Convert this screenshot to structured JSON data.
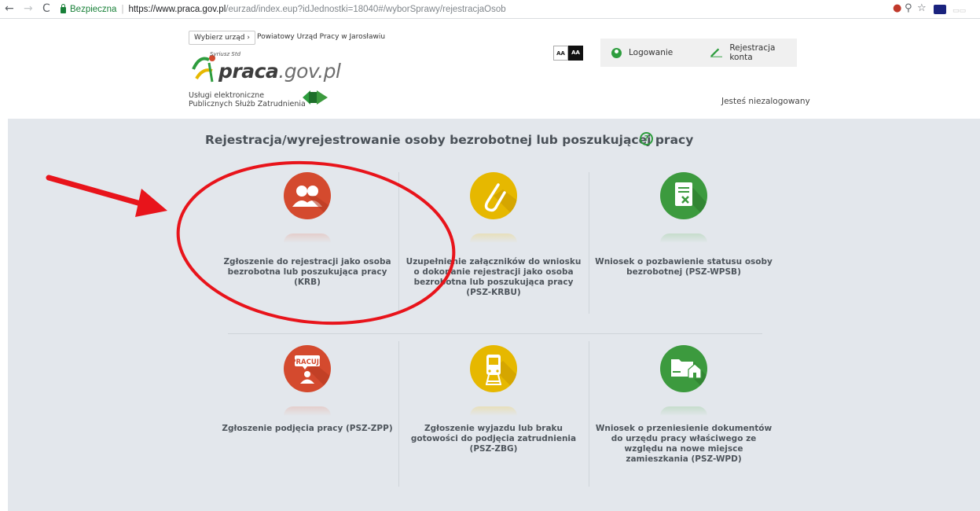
{
  "browser": {
    "secure_label": "Bezpieczna",
    "url_host": "https://www.praca.gov.pl",
    "url_path": "/eurzad/index.eup?idJednostki=18040#/wyborSprawy/rejestracjaOsob"
  },
  "header": {
    "choose_office": "Wybierz urząd  ›",
    "office_name": "Powiatowy Urząd Pracy w Jarosławiu",
    "logo_main": "praca",
    "logo_domain": ".gov.pl",
    "logo_sub": "Syriusz Std",
    "psz_line1": "Usługi elektroniczne",
    "psz_line2": "Publicznych Służb Zatrudnienia",
    "aa_small": "AA",
    "aa_large": "AA",
    "login": "Logowanie",
    "register": "Rejestracja konta",
    "status": "Jesteś niezalogowany"
  },
  "main": {
    "title": "Rejestracja/wyrejestrowanie osoby bezrobotnej lub poszukującej pracy",
    "help": "?",
    "tiles": [
      {
        "lines": [
          "Zgłoszenie do rejestracji jako osoba",
          "bezrobotna lub poszukująca pracy",
          "(KRB)"
        ],
        "color": "red",
        "icon": "people-icon"
      },
      {
        "lines": [
          "Uzupełnienie załączników do wniosku",
          "o dokonanie rejestracji jako osoba",
          "bezrobotna lub poszukująca pracy",
          "(PSZ-KRBU)"
        ],
        "color": "yellow",
        "icon": "paperclip-icon"
      },
      {
        "lines": [
          "Wniosek o pozbawienie statusu osoby",
          "bezrobotnej (PSZ-WPSB)"
        ],
        "color": "green",
        "icon": "document-x-icon"
      },
      {
        "lines": [
          "Zgłoszenie podjęcia pracy (PSZ-ZPP)"
        ],
        "color": "red",
        "icon": "pracuje-icon",
        "badge": "PRACUJĘ"
      },
      {
        "lines": [
          "Zgłoszenie wyjazdu lub braku",
          "gotowości do podjęcia zatrudnienia",
          "(PSZ-ZBG)"
        ],
        "color": "yellow",
        "icon": "train-icon"
      },
      {
        "lines": [
          "Wniosek o przeniesienie dokumentów",
          "do urzędu pracy właściwego ze",
          "względu na nowe miejsce",
          "zamieszkania (PSZ-WPD)"
        ],
        "color": "green",
        "icon": "folder-house-icon"
      }
    ]
  },
  "colors": {
    "red": "#d44a2e",
    "yellow": "#e6b800",
    "green": "#3c9a3e",
    "annotation": "#e8141b"
  }
}
